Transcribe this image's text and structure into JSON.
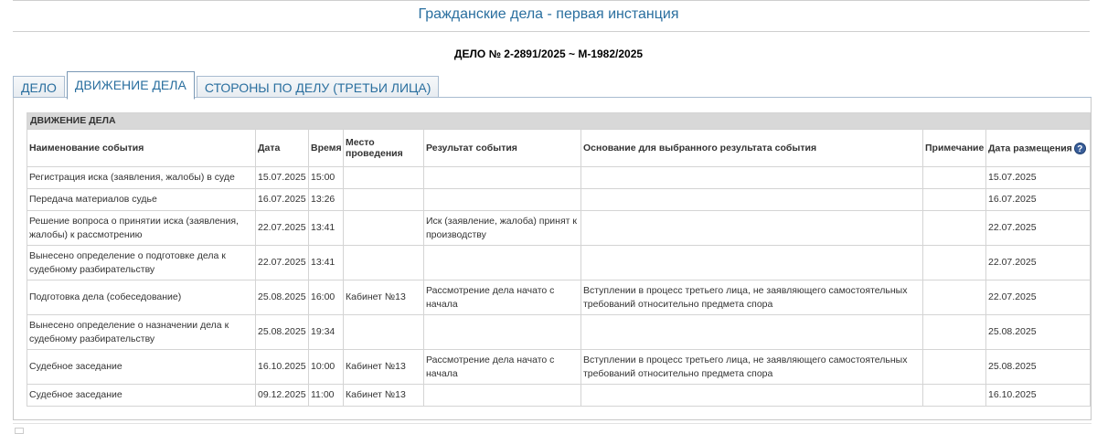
{
  "header": {
    "title": "Гражданские дела - первая инстанция",
    "case_number": "ДЕЛО № 2-2891/2025 ~ М-1982/2025"
  },
  "tabs": [
    {
      "label": "ДЕЛО",
      "active": false
    },
    {
      "label": "ДВИЖЕНИЕ ДЕЛА",
      "active": true
    },
    {
      "label": "СТОРОНЫ ПО ДЕЛУ (ТРЕТЬИ ЛИЦА)",
      "active": false
    }
  ],
  "table": {
    "section_title": "ДВИЖЕНИЕ ДЕЛА",
    "columns": {
      "event": "Наименование события",
      "date": "Дата",
      "time": "Время",
      "place": "Место проведения",
      "result": "Результат события",
      "basis": "Основание для выбранного результата события",
      "note": "Примечание",
      "posted": "Дата размещения"
    },
    "help_icon": "help-icon",
    "rows": [
      {
        "event": "Регистрация иска (заявления, жалобы) в суде",
        "date": "15.07.2025",
        "time": "15:00",
        "place": "",
        "result": "",
        "basis": "",
        "note": "",
        "posted": "15.07.2025"
      },
      {
        "event": "Передача материалов судье",
        "date": "16.07.2025",
        "time": "13:26",
        "place": "",
        "result": "",
        "basis": "",
        "note": "",
        "posted": "16.07.2025"
      },
      {
        "event": "Решение вопроса о принятии иска (заявления, жалобы) к рассмотрению",
        "date": "22.07.2025",
        "time": "13:41",
        "place": "",
        "result": "Иск (заявление, жалоба) принят к производству",
        "basis": "",
        "note": "",
        "posted": "22.07.2025"
      },
      {
        "event": "Вынесено определение о подготовке дела к судебному разбирательству",
        "date": "22.07.2025",
        "time": "13:41",
        "place": "",
        "result": "",
        "basis": "",
        "note": "",
        "posted": "22.07.2025"
      },
      {
        "event": "Подготовка дела (собеседование)",
        "date": "25.08.2025",
        "time": "16:00",
        "place": "Кабинет №13",
        "result": "Рассмотрение дела начато с начала",
        "basis": "Вступлении в процесс третьего лица, не заявляющего самостоятельных требований относительно предмета спора",
        "note": "",
        "posted": "22.07.2025"
      },
      {
        "event": "Вынесено определение о назначении дела к судебному разбирательству",
        "date": "25.08.2025",
        "time": "19:34",
        "place": "",
        "result": "",
        "basis": "",
        "note": "",
        "posted": "25.08.2025"
      },
      {
        "event": "Судебное заседание",
        "date": "16.10.2025",
        "time": "10:00",
        "place": "Кабинет №13",
        "result": "Рассмотрение дела начато с начала",
        "basis": "Вступлении в процесс третьего лица, не заявляющего самостоятельных требований относительно предмета спора",
        "note": "",
        "posted": "25.08.2025"
      },
      {
        "event": "Судебное заседание",
        "date": "09.12.2025",
        "time": "11:00",
        "place": "Кабинет №13",
        "result": "",
        "basis": "",
        "note": "",
        "posted": "16.10.2025"
      }
    ]
  }
}
